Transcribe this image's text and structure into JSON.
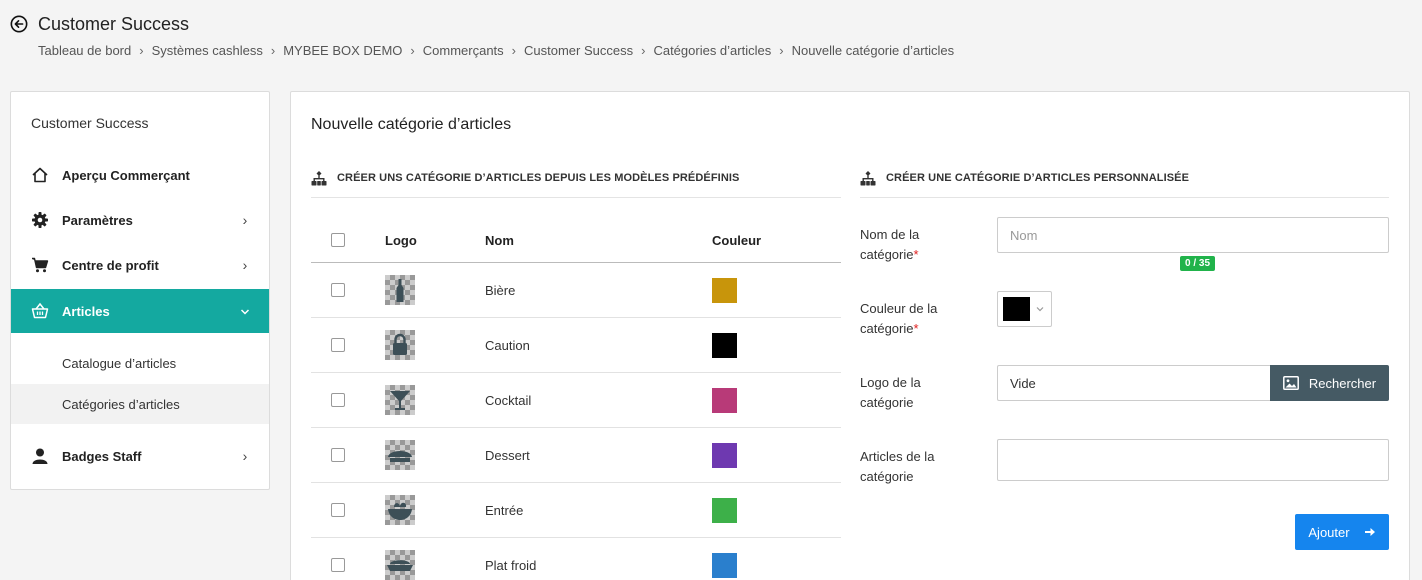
{
  "header": {
    "title": "Customer Success",
    "breadcrumb": [
      "Tableau de bord",
      "Systèmes cashless",
      "MYBEE BOX DEMO",
      "Commerçants",
      "Customer Success",
      "Catégories d’articles",
      "Nouvelle catégorie d’articles"
    ],
    "separator": "›"
  },
  "sidebar": {
    "title": "Customer Success",
    "items": [
      {
        "label": "Aperçu Commerçant",
        "icon": "home-icon"
      },
      {
        "label": "Paramètres",
        "icon": "gear-icon",
        "chevron": "›"
      },
      {
        "label": "Centre de profit",
        "icon": "cart-icon",
        "chevron": "›"
      },
      {
        "label": "Articles",
        "icon": "basket-icon",
        "chevron": "⌄",
        "active": true
      },
      {
        "label": "Badges Staff",
        "icon": "user-icon",
        "chevron": "›"
      }
    ],
    "subitems": [
      {
        "label": "Catalogue d’articles"
      },
      {
        "label": "Catégories d’articles",
        "selected": true
      }
    ]
  },
  "main": {
    "title": "Nouvelle catégorie d’articles",
    "predefined": {
      "heading": "CRÉER UNS CATÉGORIE D’ARTICLES DEPUIS LES MODÈLES PRÉDÉFINIS",
      "columns": {
        "logo": "Logo",
        "name": "Nom",
        "color": "Couleur"
      },
      "rows": [
        {
          "name": "Bière",
          "color": "#c8950b",
          "logo": "beer-bottle-icon"
        },
        {
          "name": "Caution",
          "color": "#000000",
          "logo": "padlock-icon"
        },
        {
          "name": "Cocktail",
          "color": "#b83a78",
          "logo": "cocktail-glass-icon"
        },
        {
          "name": "Dessert",
          "color": "#6e39b0",
          "logo": "dessert-icon"
        },
        {
          "name": "Entrée",
          "color": "#3db049",
          "logo": "salad-bowl-icon"
        },
        {
          "name": "Plat froid",
          "color": "#2a7fcd",
          "logo": "dish-icon"
        }
      ]
    },
    "custom": {
      "heading": "CRÉER UNE CATÉGORIE D’ARTICLES PERSONNALISÉE",
      "name_label": "Nom de la catégorie",
      "name_placeholder": "Nom",
      "name_value": "",
      "counter": "0 / 35",
      "color_label": "Couleur de la catégorie",
      "color_value": "#000000",
      "logo_label": "Logo de la catégorie",
      "logo_value": "Vide",
      "search_label": "Rechercher",
      "articles_label": "Articles de la catégorie",
      "required_mark": "*",
      "submit_label": "Ajouter"
    }
  }
}
